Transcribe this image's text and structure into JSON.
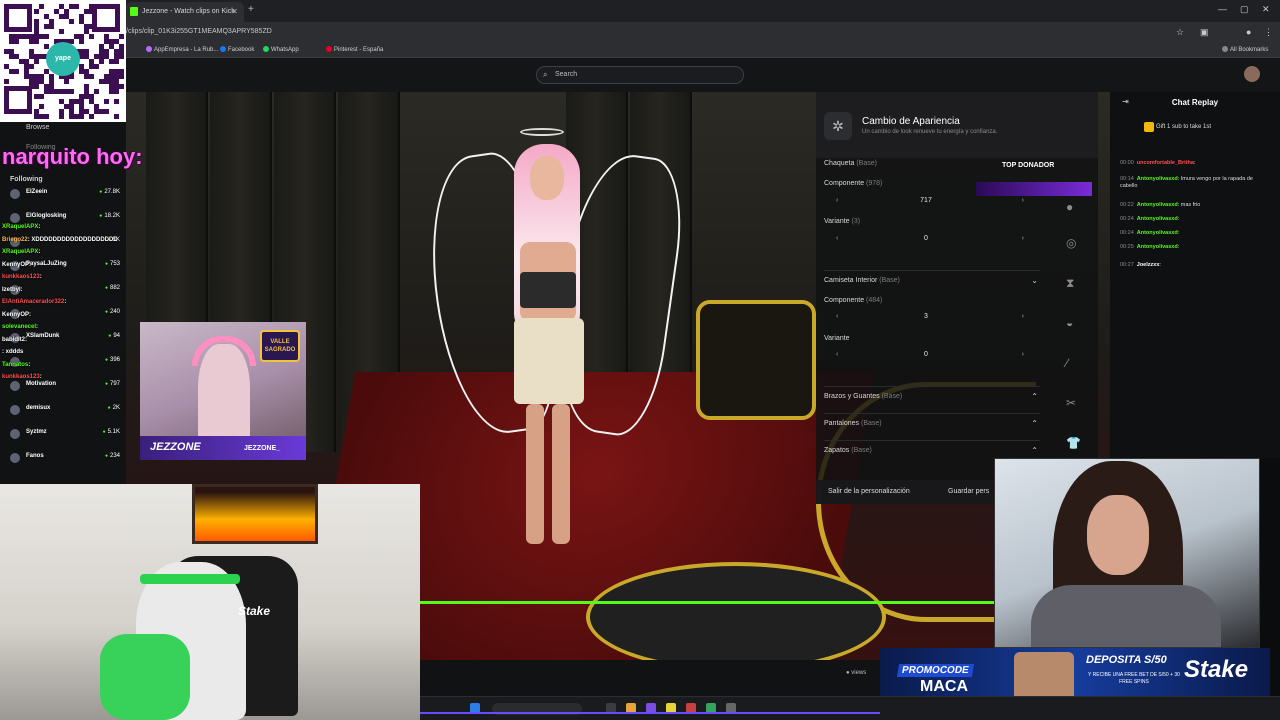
{
  "browser": {
    "tab_title": "Jezzone - Watch clips on Kick",
    "url": "/clips/clip_01K3i255GT1MEAMQ3APRY585ZD",
    "bookmarks": [
      "AppEmpresa - La Rub...",
      "Facebook",
      "WhatsApp",
      "Pinterest - España"
    ],
    "all_bookmarks": "All Bookmarks"
  },
  "kick": {
    "search_placeholder": "Search",
    "browse_label": "Browse",
    "following_label": "Following",
    "following_header": "Following",
    "channels": [
      {
        "name": "ElZeein",
        "viewers": "27.8K"
      },
      {
        "name": "ElGloglosking",
        "viewers": "18.2K"
      },
      {
        "name": "",
        "viewers": "5K"
      },
      {
        "name": "PaysaLJuZing",
        "viewers": "753"
      },
      {
        "name": "",
        "viewers": "882"
      },
      {
        "name": "",
        "viewers": "240"
      },
      {
        "name": "XSlamDunk",
        "viewers": "94"
      },
      {
        "name": "",
        "viewers": "396"
      },
      {
        "name": "Motivation",
        "viewers": "797"
      },
      {
        "name": "demisux",
        "viewers": "2K"
      },
      {
        "name": "Syztmz",
        "viewers": "5.1K"
      },
      {
        "name": "Fanos",
        "viewers": "234"
      }
    ],
    "views_label": "views"
  },
  "overlay_chat": [
    {
      "user": "XRaquelAPX",
      "text": ":",
      "color": "#53fc18"
    },
    {
      "user": "Briego22",
      "text": ": XDDDDDDDDDDDDDDDDDDD",
      "color": "#ffb347"
    },
    {
      "user": "XRaquelAPX",
      "text": ":",
      "color": "#53fc18"
    },
    {
      "user": "KennyOP",
      "text": ":",
      "color": "#ffffff"
    },
    {
      "user": "kunkkaos123",
      "text": ":",
      "color": "#ff4f4f"
    },
    {
      "user": "Izetbyl",
      "text": ":",
      "color": "#ffffff"
    },
    {
      "user": "ElAntiAmacerador322",
      "text": ":",
      "color": "#ff4f4f"
    },
    {
      "user": "KennyOP",
      "text": ":",
      "color": "#ffffff"
    },
    {
      "user": "solevanecel",
      "text": ":",
      "color": "#53fc18"
    },
    {
      "user": "babidit2",
      "text": ":",
      "color": "#ffffff"
    },
    {
      "user": "",
      "text": ": xddds",
      "color": "#ff4f4f"
    },
    {
      "user": "Tannatos",
      "text": ":",
      "color": "#53fc18"
    },
    {
      "user": "kunkkaos123",
      "text": ":",
      "color": "#ff4f4f"
    }
  ],
  "overlay_big_text": "narquito hoy:",
  "game": {
    "panel_title": "Cambio de Apariencia",
    "panel_subtitle": "Un cambio de look renueve tu energía y confianza.",
    "top_donor": "TOP DONADOR",
    "chaqueta": "Chaqueta",
    "base": "(Base)",
    "componente": "Componente",
    "componente_count_1": "(978)",
    "componente_value_1": "717",
    "componente_max_1": "1",
    "variante": "Variante",
    "variante_count_1": "(3)",
    "variante_value_1": "0",
    "camiseta": "Camiseta Interior",
    "componente_count_2": "(484)",
    "componente_value_2": "3",
    "variante_value_2": "0",
    "brazos": "Brazos y Guantes",
    "pantalones": "Pantalones",
    "zapatos": "Zapatos",
    "exit_button": "Salir de la personalización",
    "save_button": "Guardar pers",
    "sagrado_badge": "VALLE SAGRADO",
    "streamer_tag": "JEZZONE",
    "streamer_tag_small": "JEZZONE_"
  },
  "chat": {
    "title": "Chat Replay",
    "gift_text": "Gift 1 sub to take 1st",
    "messages": [
      {
        "time": "00:00",
        "user": "uncomfortable_Britha",
        "text": "",
        "color": "#ff4f4f"
      },
      {
        "time": "00:14",
        "user": "Antonyolivasxd",
        "text": "Imura vengo por la rapada de cabello",
        "color": "#53fc18"
      },
      {
        "time": "00:22",
        "user": "Antonyolivasxd",
        "text": "mas frio",
        "color": "#53fc18"
      },
      {
        "time": "00:24",
        "user": "Antonyolivasxd",
        "text": "",
        "color": "#53fc18"
      },
      {
        "time": "00:24",
        "user": "Antonyolivasxd",
        "text": "",
        "color": "#53fc18"
      },
      {
        "time": "00:25",
        "user": "Antonyolivasxd",
        "text": "",
        "color": "#53fc18"
      },
      {
        "time": "00:27",
        "user": "Joelzzxx",
        "text": "",
        "color": "#ffffff"
      }
    ]
  },
  "ad": {
    "promo": "PROMOCODE",
    "code": "MACA",
    "deposit": "DEPOSITA S/50",
    "fine_print": "Y RECIBE UNA FREE BET DE S/50 + 30 FREE SPINS",
    "brand": "Stake"
  },
  "cam_left": {
    "brand": "Stake"
  },
  "qr": {
    "label": "yape"
  },
  "colors": {
    "kick_green": "#53fc18",
    "overlay_pink": "#ff6bf3",
    "gold": "#c9a82a"
  }
}
